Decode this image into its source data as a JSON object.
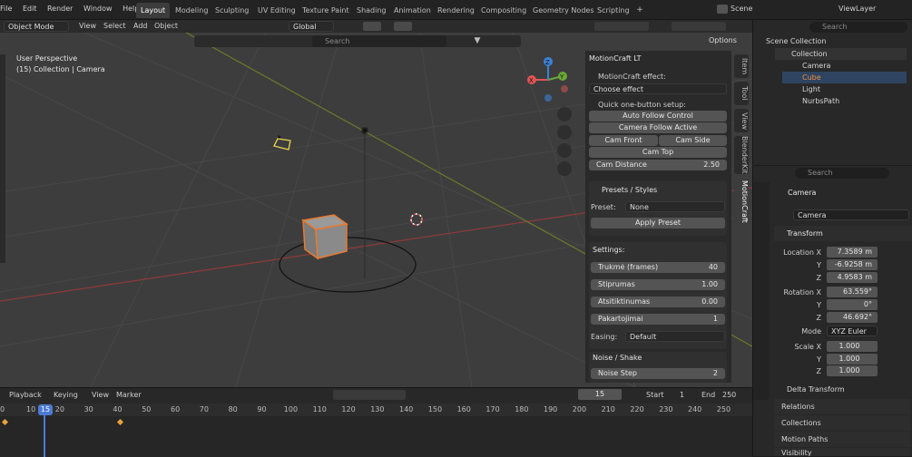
{
  "menu": [
    "File",
    "Edit",
    "Render",
    "Window",
    "Help"
  ],
  "workspaces": [
    "Layout",
    "Modeling",
    "Sculpting",
    "UV Editing",
    "Texture Paint",
    "Shading",
    "Animation",
    "Rendering",
    "Compositing",
    "Geometry Nodes",
    "Scripting"
  ],
  "top_right": {
    "scene_label": "Scene",
    "view_layer": "ViewLayer"
  },
  "viewport_header": {
    "mode": "Object Mode",
    "view": "View",
    "select": "Select",
    "add": "Add",
    "object": "Object",
    "orientation": "Global",
    "options": "Options",
    "search_placeholder": "Search"
  },
  "viewport": {
    "perspective": "User Perspective",
    "collection_info": "(15) Collection | Camera"
  },
  "gizmo": {
    "x": "X",
    "y": "Y",
    "z": "Z",
    "colors": {
      "x": "#e05555",
      "y": "#6aa83a",
      "z": "#3b82d6"
    }
  },
  "side_tabs": [
    "Item",
    "Tool",
    "View",
    "BlenderKit",
    "MotionCraft"
  ],
  "motioncraft": {
    "title": "MotionCraft LT",
    "effect_label": "MotionCraft effect:",
    "effect_value": "Choose effect",
    "quick_label": "Quick one-button setup:",
    "auto_follow": "Auto Follow Control",
    "cam_follow": "Camera Follow Active",
    "cam_front": "Cam Front",
    "cam_side": "Cam Side",
    "cam_top": "Cam Top",
    "cam_distance_label": "Cam Distance",
    "cam_distance_value": "2.50",
    "presets_title": "Presets / Styles",
    "preset_label": "Preset:",
    "preset_value": "None",
    "apply_preset": "Apply Preset",
    "settings_title": "Settings:",
    "settings": [
      {
        "label": "Trukmė (frames)",
        "value": "40"
      },
      {
        "label": "Stiprumas",
        "value": "1.00"
      },
      {
        "label": "Atsitiktinumas",
        "value": "0.00"
      },
      {
        "label": "Pakartojimai",
        "value": "1"
      }
    ],
    "easing_label": "Easing:",
    "easing_value": "Default",
    "noise_title": "Noise / Shake",
    "noise_step_label": "Noise Step",
    "noise_step_value": "2"
  },
  "outliner": {
    "search_placeholder": "Search",
    "scene_collection": "Scene Collection",
    "collection": "Collection",
    "items": [
      {
        "name": "Camera",
        "color": "#d6d6d6"
      },
      {
        "name": "Cube",
        "color": "#e8904a"
      },
      {
        "name": "Light",
        "color": "#d6d6d6"
      },
      {
        "name": "NurbsPath",
        "color": "#d6d6d6"
      }
    ]
  },
  "properties": {
    "search_placeholder": "Search",
    "object_name": "Camera",
    "object_name_field": "Camera",
    "transform_title": "Transform",
    "location": {
      "label": "Location X",
      "y": "Y",
      "z": "Z",
      "x_val": "7.3589 m",
      "y_val": "-6.9258 m",
      "z_val": "4.9583 m"
    },
    "rotation": {
      "label": "Rotation X",
      "y": "Y",
      "z": "Z",
      "x_val": "63.559°",
      "y_val": "0°",
      "z_val": "46.692°"
    },
    "mode_label": "Mode",
    "mode_value": "XYZ Euler",
    "scale": {
      "label": "Scale X",
      "y": "Y",
      "z": "Z",
      "x_val": "1.000",
      "y_val": "1.000",
      "z_val": "1.000"
    },
    "delta": "Delta Transform",
    "relations": "Relations",
    "collections": "Collections",
    "motion_paths": "Motion Paths",
    "visibility": "Visibility"
  },
  "timeline": {
    "playback": "Playback",
    "keying": "Keying",
    "view": "View",
    "marker": "Marker",
    "current_frame": "15",
    "start_label": "Start",
    "start": "1",
    "end_label": "End",
    "end": "250",
    "ticks": [
      "0",
      "10",
      "15",
      "20",
      "30",
      "40",
      "50",
      "60",
      "70",
      "80",
      "90",
      "100",
      "110",
      "120",
      "130",
      "140",
      "150",
      "160",
      "170",
      "180",
      "190",
      "200",
      "210",
      "220",
      "230",
      "240",
      "250"
    ]
  }
}
